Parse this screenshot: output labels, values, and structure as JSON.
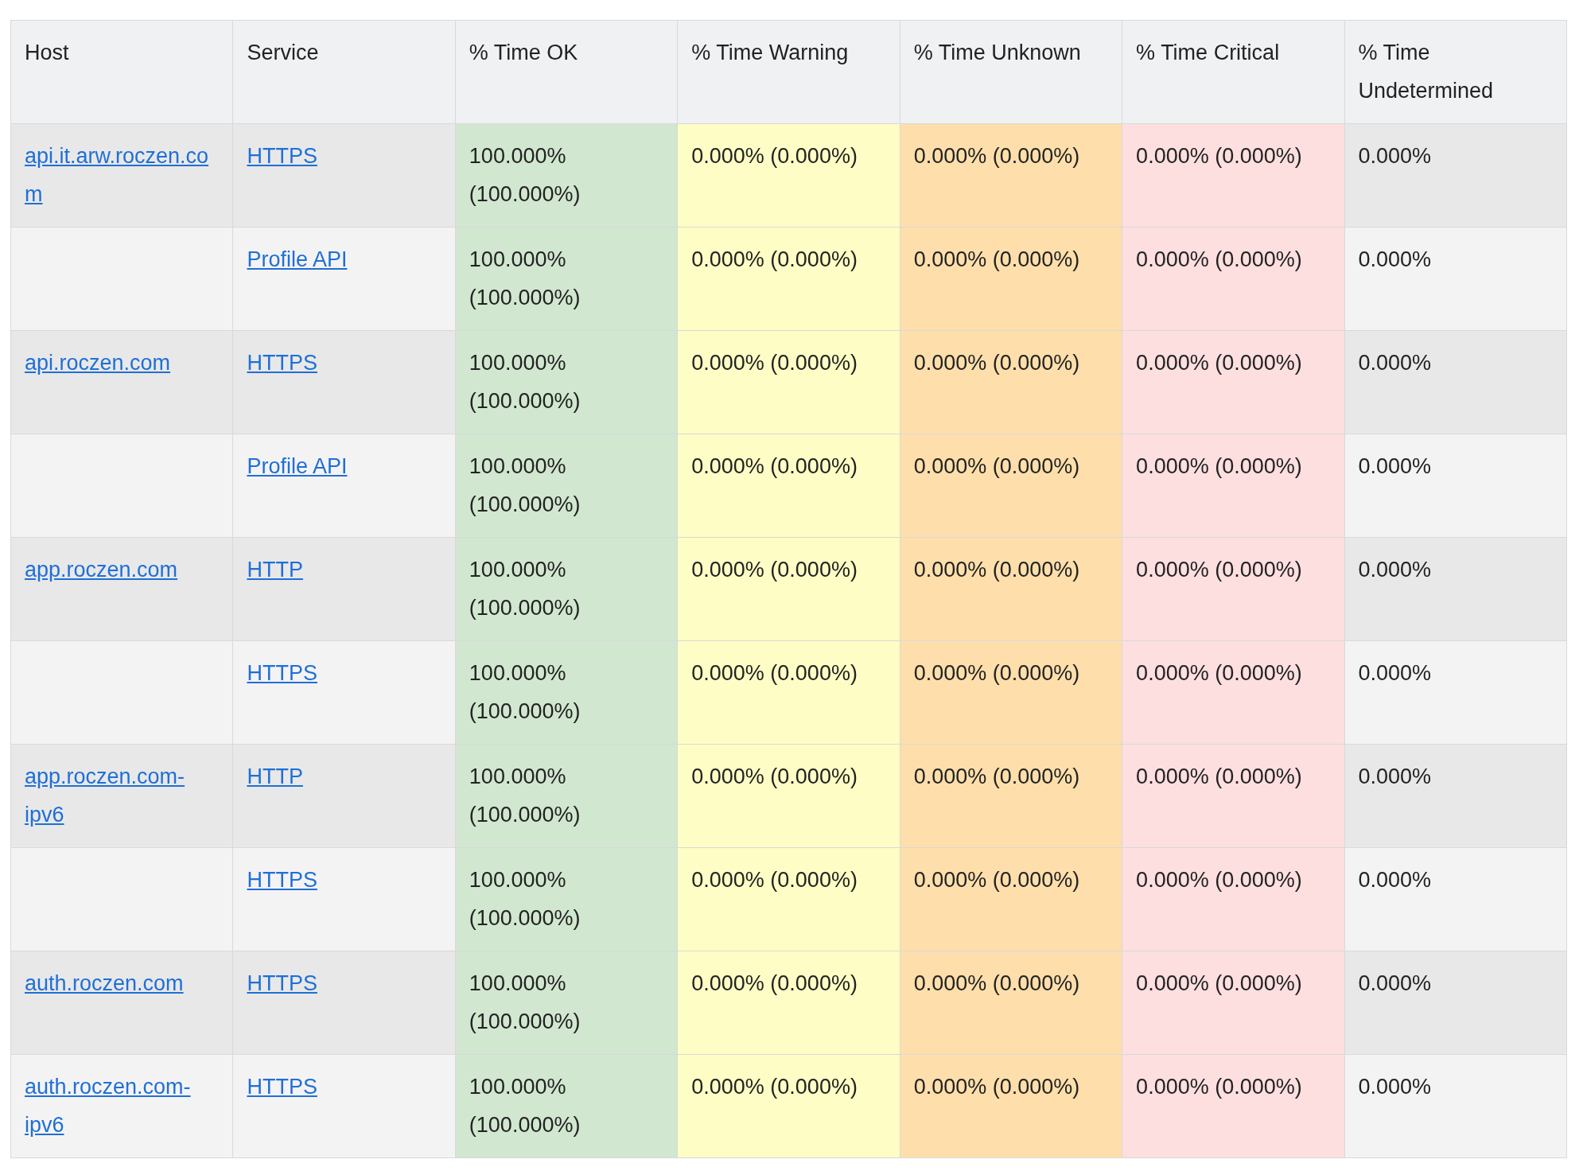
{
  "table": {
    "columns": [
      {
        "label": "Host"
      },
      {
        "label": "Service"
      },
      {
        "label": "% Time OK",
        "kind": "ok"
      },
      {
        "label": "% Time Warning",
        "kind": "warning"
      },
      {
        "label": "% Time Unknown",
        "kind": "unknown"
      },
      {
        "label": "% Time Critical",
        "kind": "critical"
      },
      {
        "label": "% Time Undetermined",
        "kind": "plain"
      }
    ],
    "rows": [
      {
        "host": "api.it.arw.roczen.com",
        "service": "HTTPS",
        "values": [
          "100.000% (100.000%)",
          "0.000% (0.000%)",
          "0.000% (0.000%)",
          "0.000% (0.000%)",
          "0.000%"
        ]
      },
      {
        "service": "Profile API",
        "values": [
          "100.000% (100.000%)",
          "0.000% (0.000%)",
          "0.000% (0.000%)",
          "0.000% (0.000%)",
          "0.000%"
        ]
      },
      {
        "host": "api.roczen.com",
        "service": "HTTPS",
        "values": [
          "100.000% (100.000%)",
          "0.000% (0.000%)",
          "0.000% (0.000%)",
          "0.000% (0.000%)",
          "0.000%"
        ]
      },
      {
        "service": "Profile API",
        "values": [
          "100.000% (100.000%)",
          "0.000% (0.000%)",
          "0.000% (0.000%)",
          "0.000% (0.000%)",
          "0.000%"
        ]
      },
      {
        "host": "app.roczen.com",
        "service": "HTTP",
        "values": [
          "100.000% (100.000%)",
          "0.000% (0.000%)",
          "0.000% (0.000%)",
          "0.000% (0.000%)",
          "0.000%"
        ]
      },
      {
        "service": "HTTPS",
        "values": [
          "100.000% (100.000%)",
          "0.000% (0.000%)",
          "0.000% (0.000%)",
          "0.000% (0.000%)",
          "0.000%"
        ]
      },
      {
        "host": "app.roczen.com-ipv6",
        "service": "HTTP",
        "values": [
          "100.000% (100.000%)",
          "0.000% (0.000%)",
          "0.000% (0.000%)",
          "0.000% (0.000%)",
          "0.000%"
        ]
      },
      {
        "service": "HTTPS",
        "values": [
          "100.000% (100.000%)",
          "0.000% (0.000%)",
          "0.000% (0.000%)",
          "0.000% (0.000%)",
          "0.000%"
        ]
      },
      {
        "host": "auth.roczen.com",
        "service": "HTTPS",
        "values": [
          "100.000% (100.000%)",
          "0.000% (0.000%)",
          "0.000% (0.000%)",
          "0.000% (0.000%)",
          "0.000%"
        ]
      },
      {
        "host": "auth.roczen.com-ipv6",
        "service": "HTTPS",
        "values": [
          "100.000% (100.000%)",
          "0.000% (0.000%)",
          "0.000% (0.000%)",
          "0.000% (0.000%)",
          "0.000%"
        ]
      }
    ]
  }
}
